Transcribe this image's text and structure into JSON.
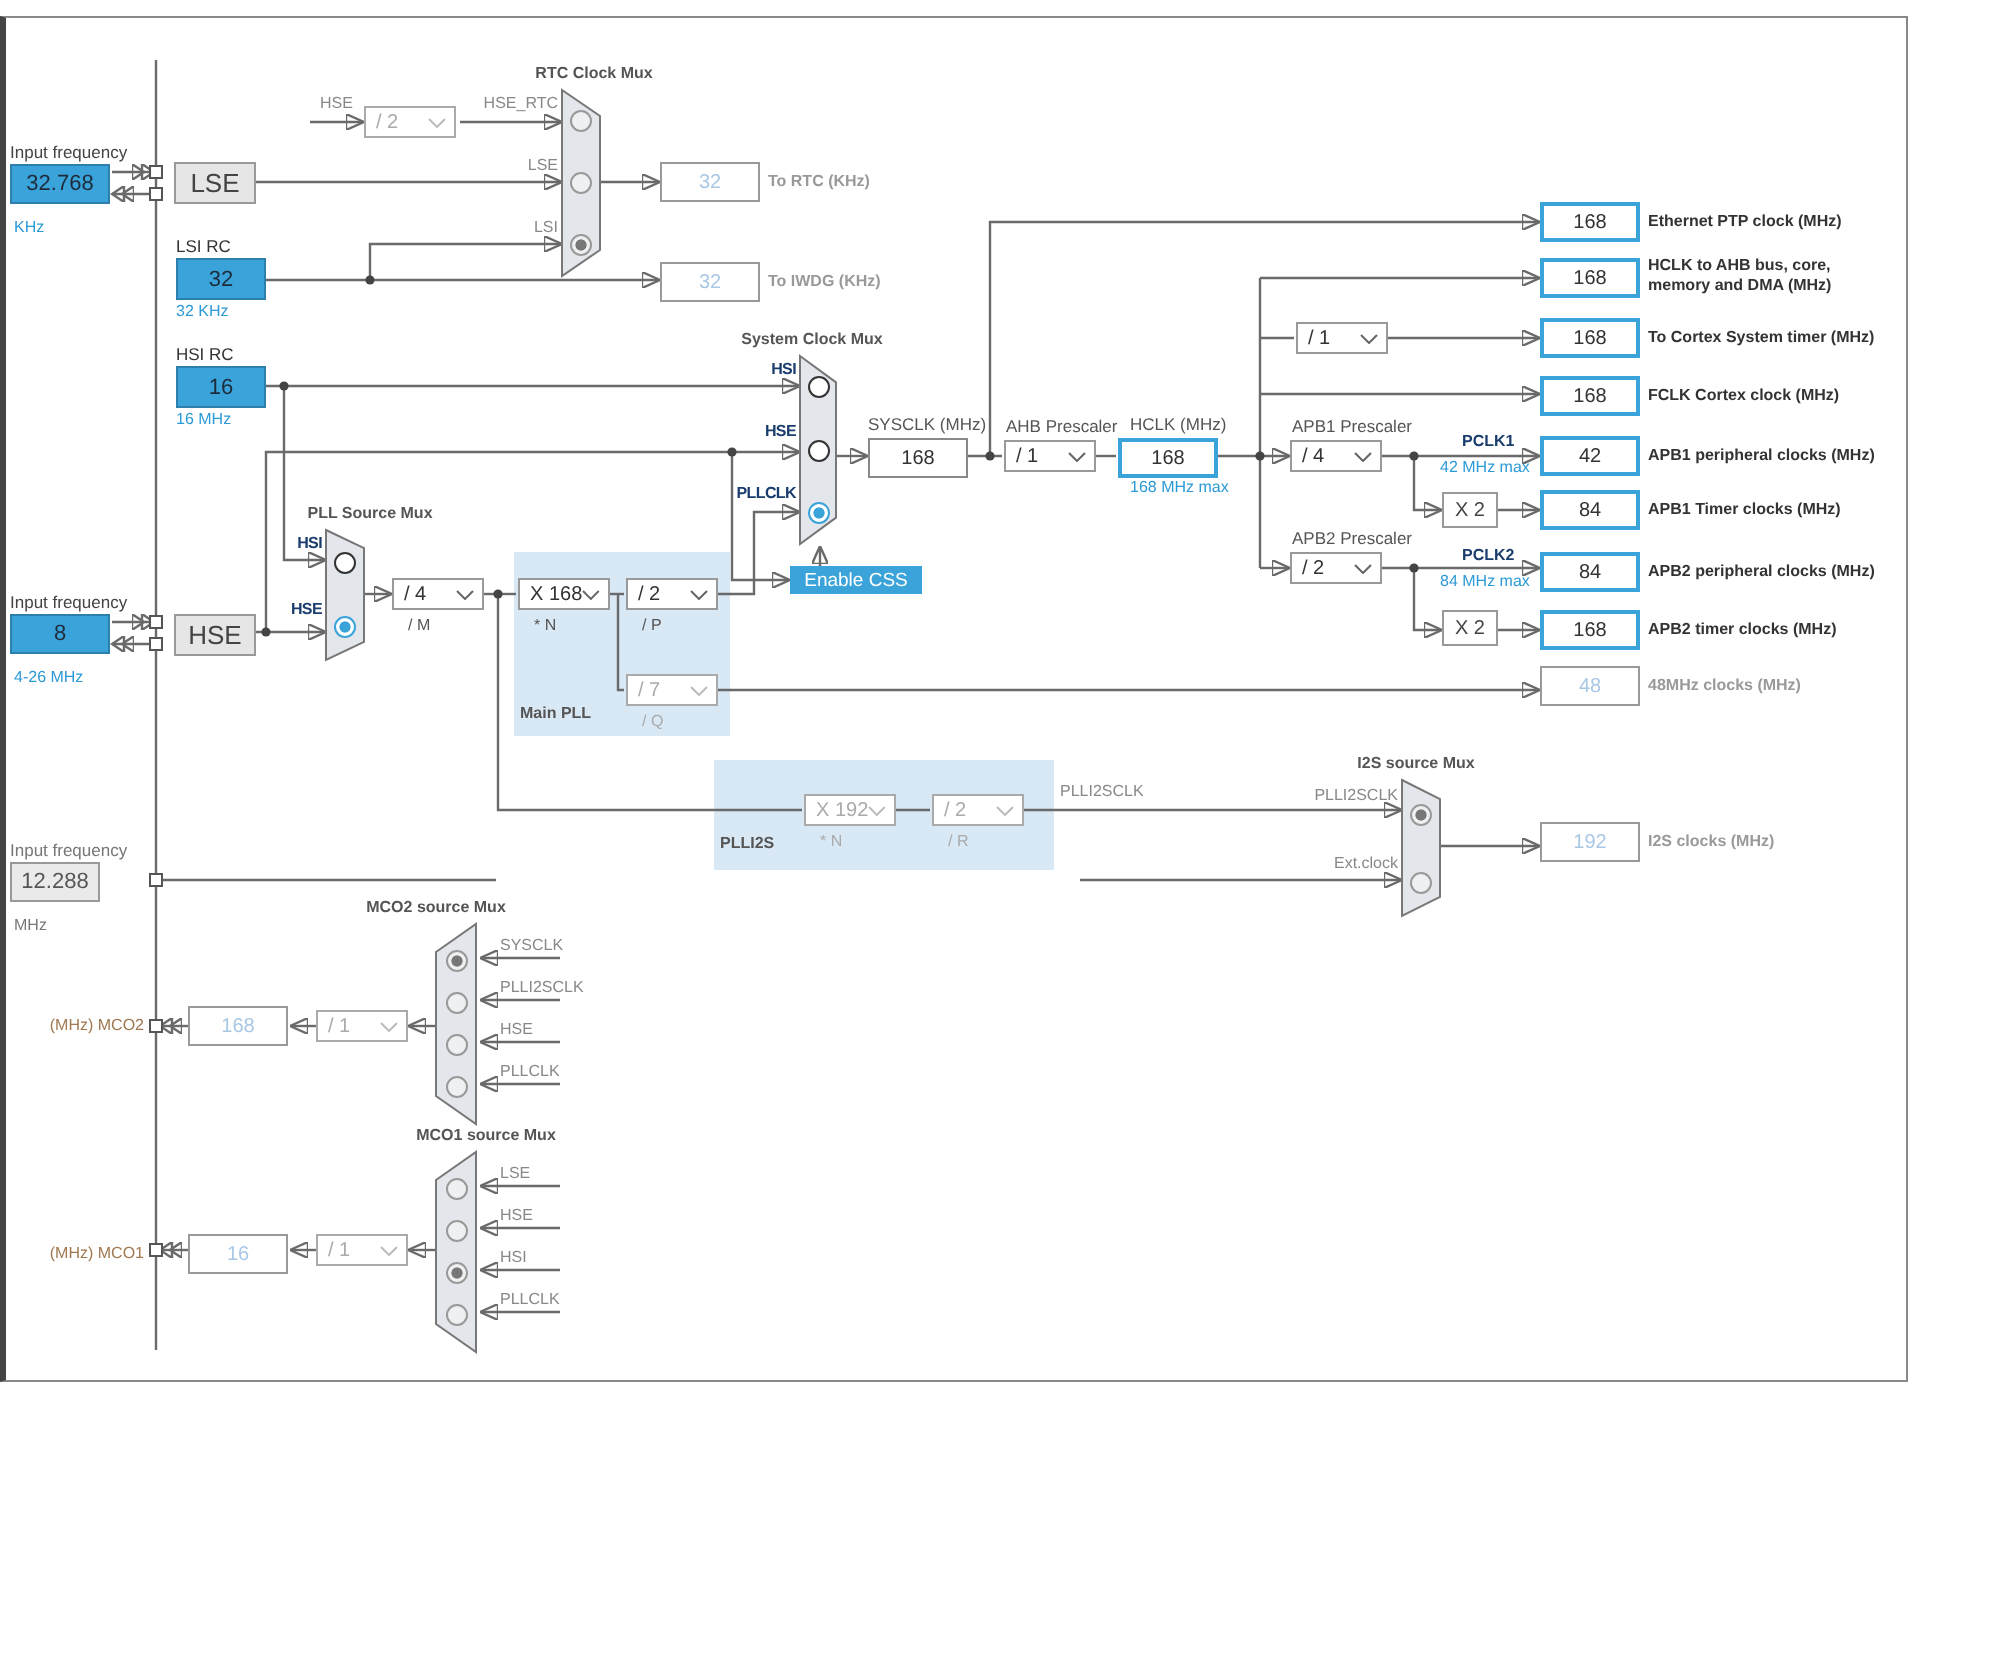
{
  "inputs": [
    {
      "label": "Input frequency",
      "value": "32.768",
      "unit": "KHz",
      "disabled": false
    },
    {
      "label": "Input frequency",
      "value": "8",
      "unit": "4-26 MHz",
      "disabled": false
    },
    {
      "label": "Input frequency",
      "value": "12.288",
      "unit": "MHz",
      "disabled": true
    }
  ],
  "oscillators": [
    {
      "name": "LSE"
    },
    {
      "name": "HSE"
    }
  ],
  "rc_sources": [
    {
      "title": "LSI RC",
      "value": "32",
      "note": "32 KHz"
    },
    {
      "title": "HSI RC",
      "value": "16",
      "note": "16 MHz"
    }
  ],
  "muxes": [
    {
      "title": "RTC Clock Mux",
      "disabled": true,
      "inputs": [
        {
          "label": "HSE_RTC",
          "selected": false
        },
        {
          "label": "LSE",
          "selected": false
        },
        {
          "label": "LSI",
          "selected": true
        }
      ]
    },
    {
      "title": "System Clock Mux",
      "disabled": false,
      "inputs": [
        {
          "label": "HSI",
          "selected": false
        },
        {
          "label": "HSE",
          "selected": false
        },
        {
          "label": "PLLCLK",
          "selected": true
        }
      ]
    },
    {
      "title": "PLL Source Mux",
      "disabled": false,
      "inputs": [
        {
          "label": "HSI",
          "selected": false
        },
        {
          "label": "HSE",
          "selected": true
        }
      ]
    },
    {
      "title": "I2S source Mux",
      "disabled": true,
      "inputs": [
        {
          "label": "PLLI2SCLK",
          "selected": true
        },
        {
          "label": "Ext.clock",
          "selected": false
        }
      ]
    },
    {
      "title": "MCO2 source Mux",
      "disabled": true,
      "inputs": [
        {
          "label": "SYSCLK",
          "selected": true
        },
        {
          "label": "PLLI2SCLK",
          "selected": false
        },
        {
          "label": "HSE",
          "selected": false
        },
        {
          "label": "PLLCLK",
          "selected": false
        }
      ]
    },
    {
      "title": "MCO1 source Mux",
      "disabled": true,
      "inputs": [
        {
          "label": "LSE",
          "selected": false
        },
        {
          "label": "HSE",
          "selected": false
        },
        {
          "label": "HSI",
          "selected": true
        },
        {
          "label": "PLLCLK",
          "selected": false
        }
      ]
    }
  ],
  "dropdowns": [
    {
      "value": "/ 2",
      "disabled": true
    },
    {
      "value": "/ 4",
      "caption": "/ M",
      "disabled": false
    },
    {
      "value": "X 168",
      "caption": "* N",
      "disabled": false
    },
    {
      "value": "/ 2",
      "caption": "/ P",
      "disabled": false
    },
    {
      "value": "/ 7",
      "caption": "/ Q",
      "disabled": true
    },
    {
      "value": "/ 1",
      "title": "AHB Prescaler",
      "disabled": false
    },
    {
      "value": "/ 1",
      "disabled": false
    },
    {
      "value": "/ 4",
      "title": "APB1 Prescaler",
      "disabled": false
    },
    {
      "value": "/ 2",
      "title": "APB2 Prescaler",
      "disabled": false
    },
    {
      "value": "X 192",
      "caption": "* N",
      "disabled": true
    },
    {
      "value": "/ 2",
      "caption": "/ R",
      "disabled": true
    },
    {
      "value": "/ 1",
      "disabled": true
    },
    {
      "value": "/ 1",
      "disabled": true
    }
  ],
  "multipliers": [
    {
      "value": "X 2"
    },
    {
      "value": "X 2"
    }
  ],
  "sysclk": {
    "title": "SYSCLK (MHz)",
    "value": "168"
  },
  "hclk": {
    "title": "HCLK (MHz)",
    "value": "168",
    "note": "168 MHz max"
  },
  "pclk": [
    {
      "label": "PCLK1",
      "note": "42 MHz max"
    },
    {
      "label": "PCLK2",
      "note": "84 MHz max"
    }
  ],
  "pll_groups": [
    {
      "title": "Main PLL"
    },
    {
      "title": "PLLI2S"
    }
  ],
  "css_button": {
    "label": "Enable CSS"
  },
  "wire_labels": [
    {
      "text": "HSE"
    },
    {
      "text": "PLLI2SCLK"
    }
  ],
  "outputs": [
    {
      "value": "32",
      "label": "To RTC (KHz)",
      "disabled": true
    },
    {
      "value": "32",
      "label": "To IWDG (KHz)",
      "disabled": true
    },
    {
      "value": "168",
      "label": "Ethernet PTP clock (MHz)",
      "disabled": false
    },
    {
      "value": "168",
      "label": "HCLK to AHB bus, core, memory and DMA (MHz)",
      "disabled": false
    },
    {
      "value": "168",
      "label": "To Cortex System timer (MHz)",
      "disabled": false
    },
    {
      "value": "168",
      "label": "FCLK Cortex clock (MHz)",
      "disabled": false
    },
    {
      "value": "42",
      "label": "APB1 peripheral clocks (MHz)",
      "disabled": false
    },
    {
      "value": "84",
      "label": "APB1 Timer clocks (MHz)",
      "disabled": false
    },
    {
      "value": "84",
      "label": "APB2 peripheral clocks (MHz)",
      "disabled": false
    },
    {
      "value": "168",
      "label": "APB2 timer clocks (MHz)",
      "disabled": false
    },
    {
      "value": "48",
      "label": "48MHz clocks (MHz)",
      "disabled": true
    },
    {
      "value": "192",
      "label": "I2S clocks (MHz)",
      "disabled": true
    }
  ],
  "mco_outputs": [
    {
      "label": "(MHz) MCO2",
      "value": "168",
      "disabled": true
    },
    {
      "label": "(MHz) MCO1",
      "value": "16",
      "disabled": true
    }
  ]
}
